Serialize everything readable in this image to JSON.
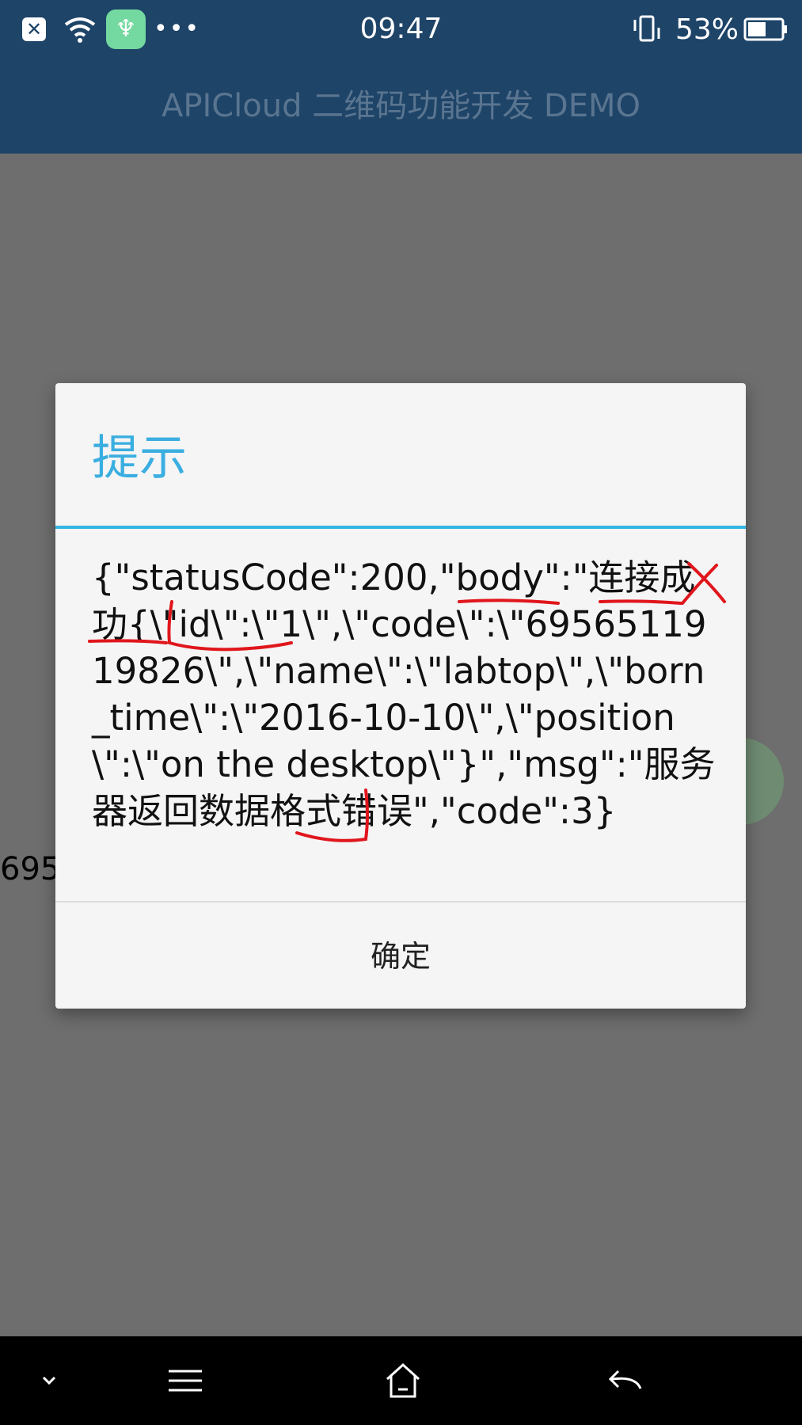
{
  "status_bar": {
    "time": "09:47",
    "battery_text": "53%",
    "icons": [
      "close-app-icon",
      "wifi-icon",
      "green-app-icon",
      "more-icon",
      "vibrate-icon",
      "battery-icon"
    ]
  },
  "app_header": {
    "title": "APICloud 二维码功能开发 DEMO"
  },
  "background": {
    "partial_number": "695"
  },
  "dialog": {
    "title": "提示",
    "message": "{\"statusCode\":200,\"body\":\"连接成功{\\\"id\\\":\\\"1\\\",\\\"code\\\":\\\"6956511919826\\\",\\\"name\\\":\\\"labtop\\\",\\\"born_time\\\":\\\"2016-10-10\\\",\\\"position\\\":\\\"on the desktop\\\"}\",\"msg\":\"服务器返回数据格式错误\",\"code\":3}",
    "confirm_label": "确定"
  },
  "colors": {
    "header_bg": "#1e4468",
    "dialog_title": "#3aaee0",
    "annotation_red": "#e0161c"
  },
  "nav_bar": {
    "icons": [
      "chevron-down-icon",
      "menu-icon",
      "home-icon",
      "back-icon"
    ]
  }
}
